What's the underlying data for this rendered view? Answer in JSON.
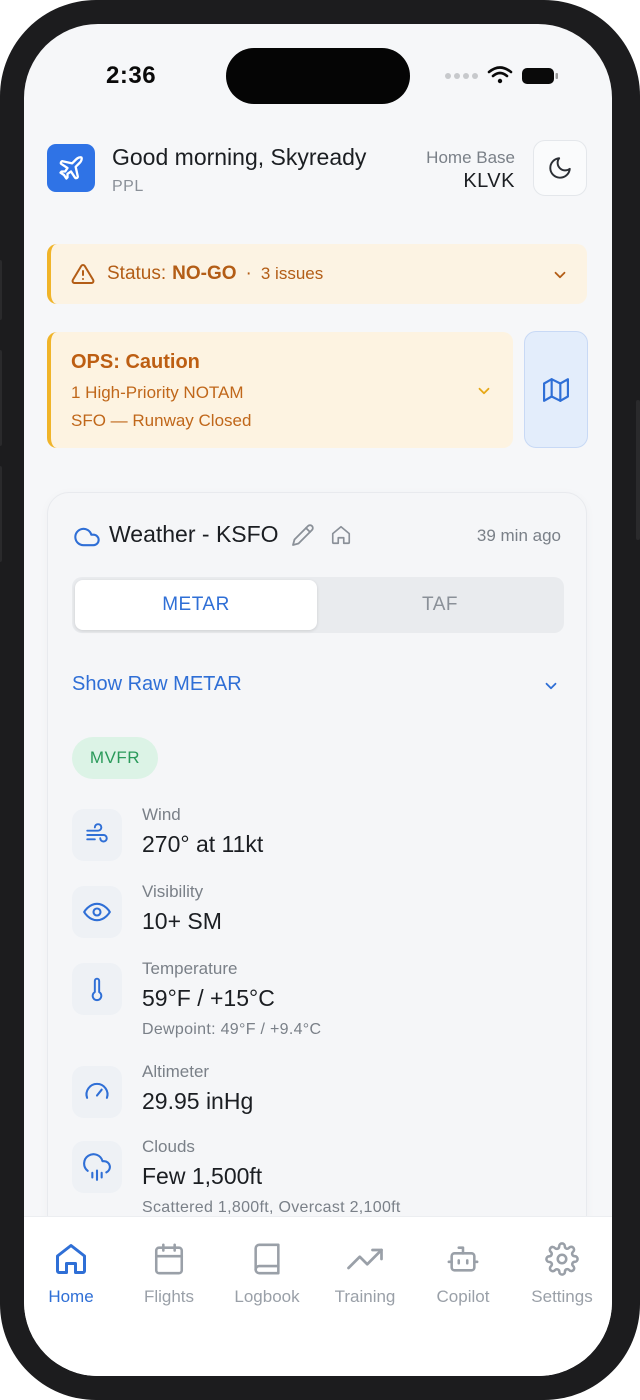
{
  "status_bar": {
    "time": "2:36"
  },
  "header": {
    "greeting": "Good morning, Skyready",
    "license": "PPL",
    "home_base_label": "Home Base",
    "home_base_code": "KLVK",
    "logo_icon": "airplane-icon",
    "theme_icon": "moon-icon"
  },
  "status": {
    "label": "Status:",
    "value": "NO-GO",
    "separator": "·",
    "issues": "3 issues",
    "icon": "warning-triangle-icon"
  },
  "ops": {
    "title": "OPS: Caution",
    "line1": "1 High-Priority NOTAM",
    "line2": "SFO — Runway Closed",
    "map_icon": "map-icon"
  },
  "weather": {
    "title": "Weather - KSFO",
    "age": "39 min ago",
    "tabs": [
      {
        "label": "METAR",
        "active": true
      },
      {
        "label": "TAF",
        "active": false
      }
    ],
    "raw_toggle": "Show Raw METAR",
    "flight_category": "MVFR",
    "rows": [
      {
        "label": "Wind",
        "value": "270° at 11kt",
        "icon": "wind-icon"
      },
      {
        "label": "Visibility",
        "value": "10+ SM",
        "icon": "eye-icon"
      },
      {
        "label": "Temperature",
        "value": "59°F / +15°C",
        "sub": "Dewpoint: 49°F / +9.4°C",
        "icon": "thermometer-icon"
      },
      {
        "label": "Altimeter",
        "value": "29.95 inHg",
        "icon": "gauge-icon"
      },
      {
        "label": "Clouds",
        "value": "Few 1,500ft",
        "sub": "Scattered 1,800ft, Overcast 2,100ft",
        "icon": "cloud-rain-icon"
      }
    ]
  },
  "tabbar": {
    "items": [
      {
        "label": "Home",
        "icon": "home-icon",
        "active": true
      },
      {
        "label": "Flights",
        "icon": "calendar-icon",
        "active": false
      },
      {
        "label": "Logbook",
        "icon": "book-icon",
        "active": false
      },
      {
        "label": "Training",
        "icon": "trending-up-icon",
        "active": false
      },
      {
        "label": "Copilot",
        "icon": "robot-icon",
        "active": false
      },
      {
        "label": "Settings",
        "icon": "gear-icon",
        "active": false
      }
    ]
  },
  "colors": {
    "accent": "#2f6fd6",
    "warning_bg": "#fcf3e3",
    "warning_text": "#b35d16",
    "mvfr_bg": "#dcf3e6",
    "mvfr_text": "#2a9a5a"
  }
}
